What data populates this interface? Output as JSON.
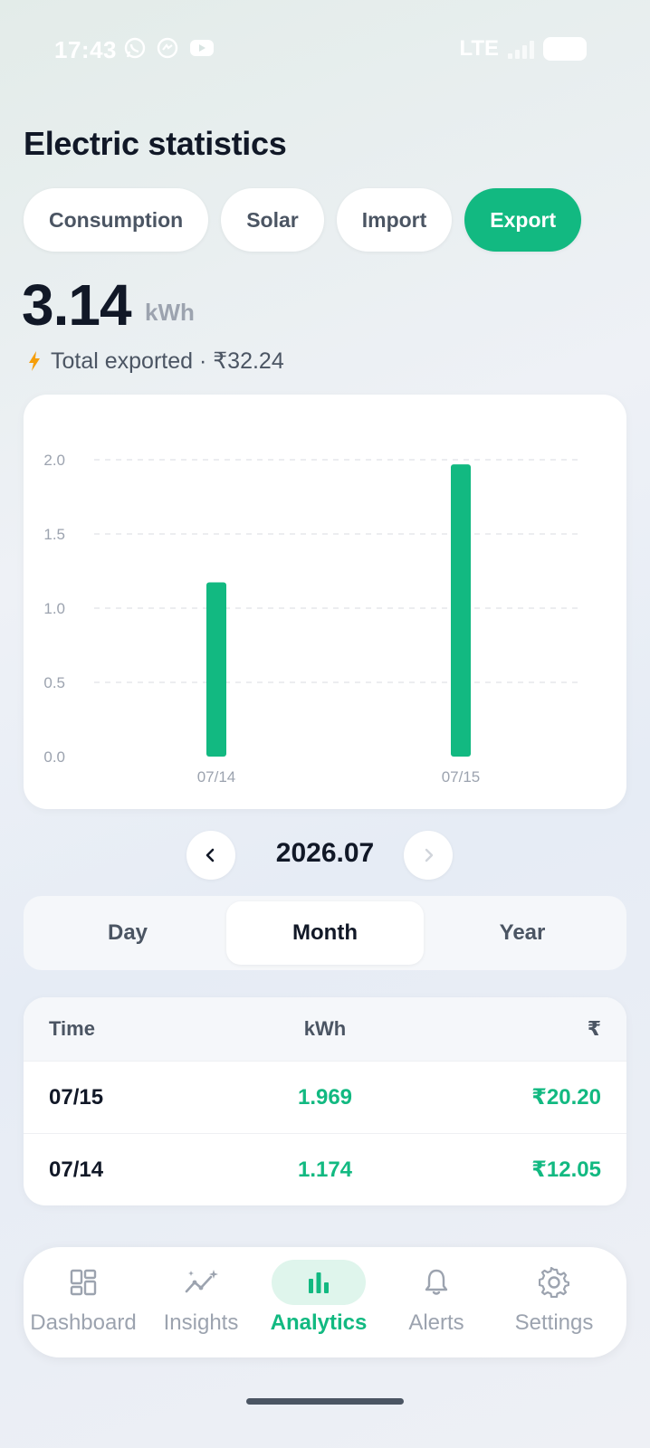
{
  "status_bar": {
    "time": "17:43",
    "network": "LTE",
    "icons": [
      "whatsapp-icon",
      "messenger-icon",
      "youtube-icon",
      "signal-icon",
      "battery-icon"
    ]
  },
  "page": {
    "title": "Electric statistics"
  },
  "tabs": [
    {
      "label": "Consumption",
      "active": false
    },
    {
      "label": "Solar",
      "active": false
    },
    {
      "label": "Import",
      "active": false
    },
    {
      "label": "Export",
      "active": true
    }
  ],
  "summary": {
    "value": "3.14",
    "unit": "kWh",
    "caption": "Total exported · ₹32.24",
    "icon": "bolt-icon"
  },
  "chart_data": {
    "type": "bar",
    "categories": [
      "07/14",
      "07/15"
    ],
    "values": [
      1.174,
      1.969
    ],
    "yticks": [
      "0.0",
      "0.5",
      "1.0",
      "1.5",
      "2.0"
    ],
    "ylim": [
      0,
      2.0
    ],
    "grid": true,
    "color": "#12b981"
  },
  "period": {
    "label": "2026.07",
    "prev_icon": "chevron-left-icon",
    "next_icon": "chevron-right-icon"
  },
  "granularity": [
    {
      "label": "Day",
      "active": false
    },
    {
      "label": "Month",
      "active": true
    },
    {
      "label": "Year",
      "active": false
    }
  ],
  "table": {
    "headers": {
      "time": "Time",
      "kwh": "kWh",
      "cost": "₹"
    },
    "rows": [
      {
        "time": "07/15",
        "kwh": "1.969",
        "cost": "₹20.20"
      },
      {
        "time": "07/14",
        "kwh": "1.174",
        "cost": "₹12.05"
      }
    ]
  },
  "bottom_nav": [
    {
      "label": "Dashboard",
      "icon": "dashboard-icon",
      "active": false
    },
    {
      "label": "Insights",
      "icon": "insights-icon",
      "active": false
    },
    {
      "label": "Analytics",
      "icon": "bar-chart-icon",
      "active": true
    },
    {
      "label": "Alerts",
      "icon": "bell-icon",
      "active": false
    },
    {
      "label": "Settings",
      "icon": "gear-icon",
      "active": false
    }
  ],
  "colors": {
    "accent": "#12b981",
    "text": "#111827",
    "muted": "#9ca3af"
  }
}
